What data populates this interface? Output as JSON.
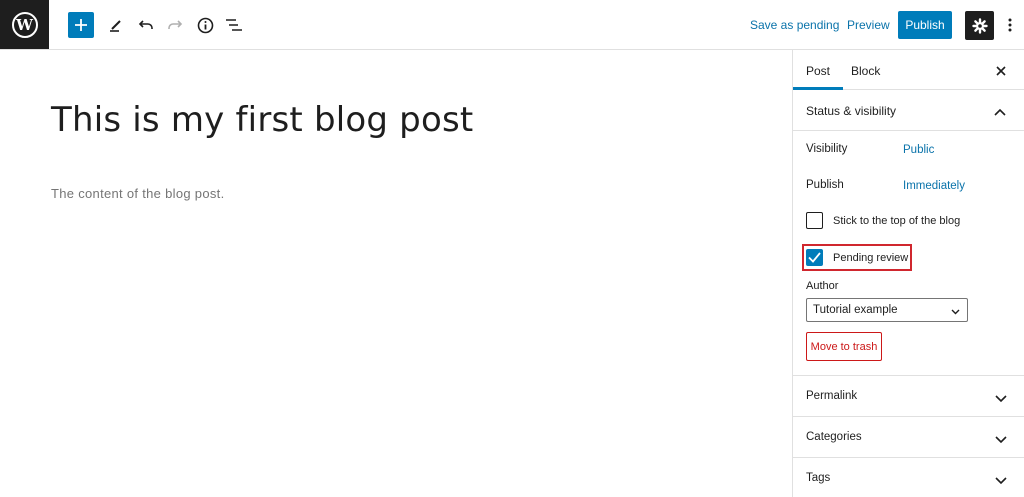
{
  "toolbar": {
    "save_pending_label": "Save as pending",
    "preview_label": "Preview",
    "publish_label": "Publish"
  },
  "editor": {
    "title": "This is my first blog post",
    "content": "The content of the blog post."
  },
  "sidebar": {
    "tabs": [
      {
        "label": "Post"
      },
      {
        "label": "Block"
      }
    ],
    "status_panel": {
      "title": "Status & visibility",
      "visibility_label": "Visibility",
      "visibility_value": "Public",
      "publish_label": "Publish",
      "publish_value": "Immediately",
      "stick_label": "Stick to the top of the blog",
      "pending_label": "Pending review",
      "author_label": "Author",
      "author_value": "Tutorial example",
      "trash_label": "Move to trash"
    },
    "sections": [
      {
        "title": "Permalink"
      },
      {
        "title": "Categories"
      },
      {
        "title": "Tags"
      }
    ]
  },
  "colors": {
    "accent": "#007cba",
    "danger": "#cc1818",
    "highlight": "#d0272e"
  }
}
